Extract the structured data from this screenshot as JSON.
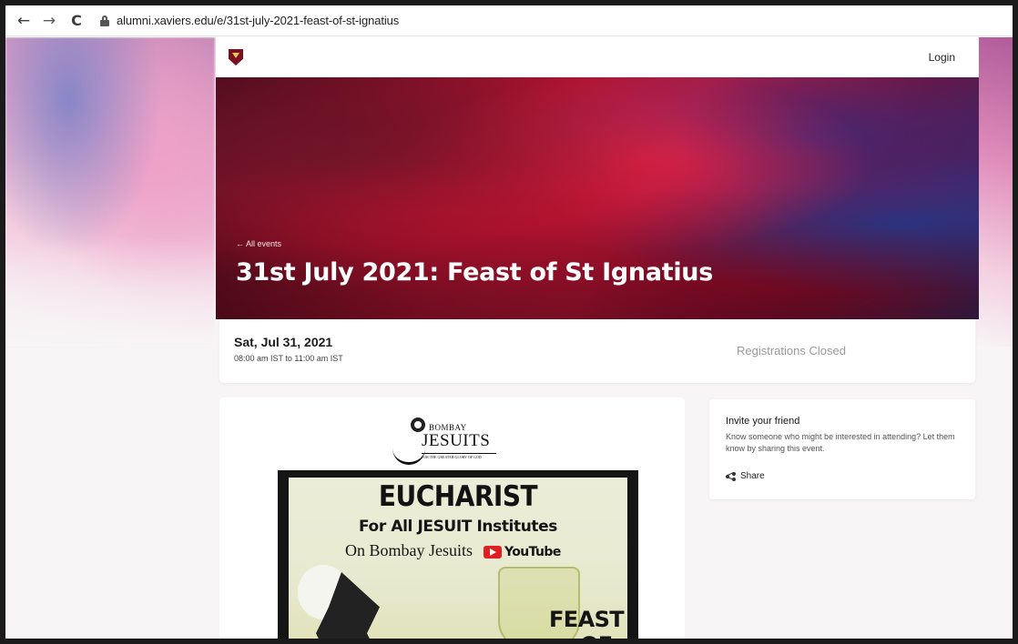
{
  "browser": {
    "url": "alumni.xaviers.edu/e/31st-july-2021-feast-of-st-ignatius",
    "back_glyph": "←",
    "forward_glyph": "→",
    "reload_glyph": "C"
  },
  "header": {
    "login_label": "Login"
  },
  "hero": {
    "back_link": "← All events",
    "title": "31st July 2021: Feast of St Ignatius"
  },
  "event": {
    "date": "Sat, Jul 31, 2021",
    "time": "08:00 am IST  to 11:00 am IST",
    "registration_status": "Registrations Closed"
  },
  "poster": {
    "org_small": "BOMBAY",
    "org_large": "JESUITS",
    "tagline": "FOR THE GREATER GLORY OF GOD",
    "heading": "EUCHARIST",
    "line2": "For All JESUIT Institutes",
    "line3": "On Bombay Jesuits",
    "platform": "YouTube",
    "feast": "FEAST",
    "of": "OF"
  },
  "invite": {
    "title": "Invite your friend",
    "description": "Know someone who might be interested in attending? Let them know by sharing this event.",
    "share_label": "Share"
  },
  "colors": {
    "hero_primary": "#c51a3c",
    "crest": "#7a1020",
    "youtube": "#e02020"
  }
}
